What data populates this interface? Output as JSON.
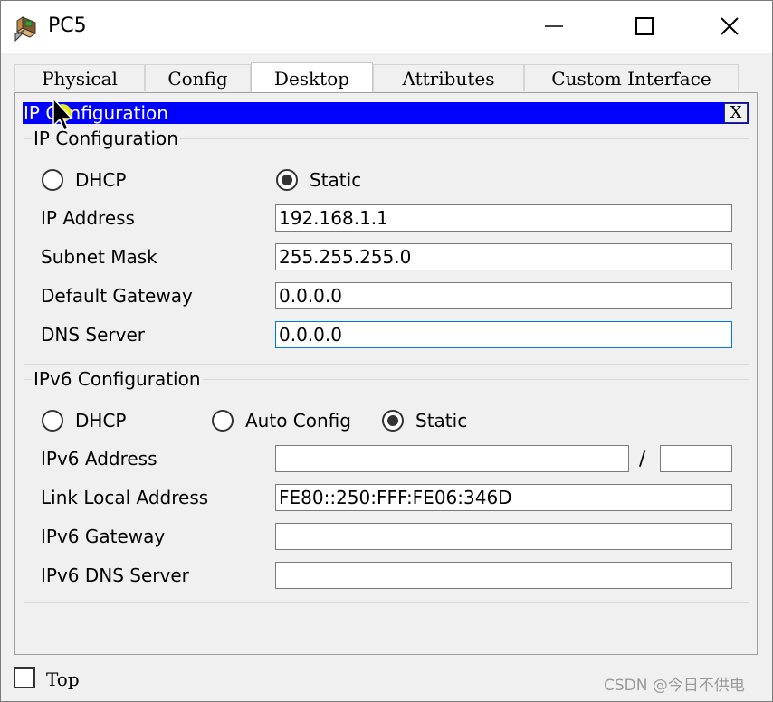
{
  "window": {
    "title": "PC5",
    "icon": "pc-folder-icon",
    "controls": [
      "minimize-icon",
      "maximize-icon",
      "close-icon"
    ]
  },
  "tabs": [
    {
      "label": "Physical",
      "active": false
    },
    {
      "label": "Config",
      "active": false
    },
    {
      "label": "Desktop",
      "active": true
    },
    {
      "label": "Attributes",
      "active": false
    },
    {
      "label": "Custom Interface",
      "active": false
    }
  ],
  "panel": {
    "title": "IP Configuration",
    "close_label": "X",
    "header_color": "#0000ff"
  },
  "ipv4": {
    "legend": "IP Configuration",
    "dhcp_label": "DHCP",
    "static_label": "Static",
    "selected": "Static",
    "fields": [
      {
        "label": "IP Address",
        "value": "192.168.1.1"
      },
      {
        "label": "Subnet Mask",
        "value": "255.255.255.0"
      },
      {
        "label": "Default Gateway",
        "value": "0.0.0.0"
      },
      {
        "label": "DNS Server",
        "value": "0.0.0.0"
      }
    ]
  },
  "ipv6": {
    "legend": "IPv6 Configuration",
    "dhcp_label": "DHCP",
    "auto_label": "Auto Config",
    "static_label": "Static",
    "selected": "Static",
    "address_label": "IPv6 Address",
    "address_value": "",
    "prefix_separator": "/",
    "prefix_value": "",
    "fields": [
      {
        "label": "Link Local Address",
        "value": "FE80::250:FFF:FE06:346D"
      },
      {
        "label": "IPv6 Gateway",
        "value": ""
      },
      {
        "label": "IPv6 DNS Server",
        "value": ""
      }
    ]
  },
  "footer": {
    "top_label": "Top",
    "top_checked": false,
    "watermark": "CSDN @今日不供电"
  }
}
